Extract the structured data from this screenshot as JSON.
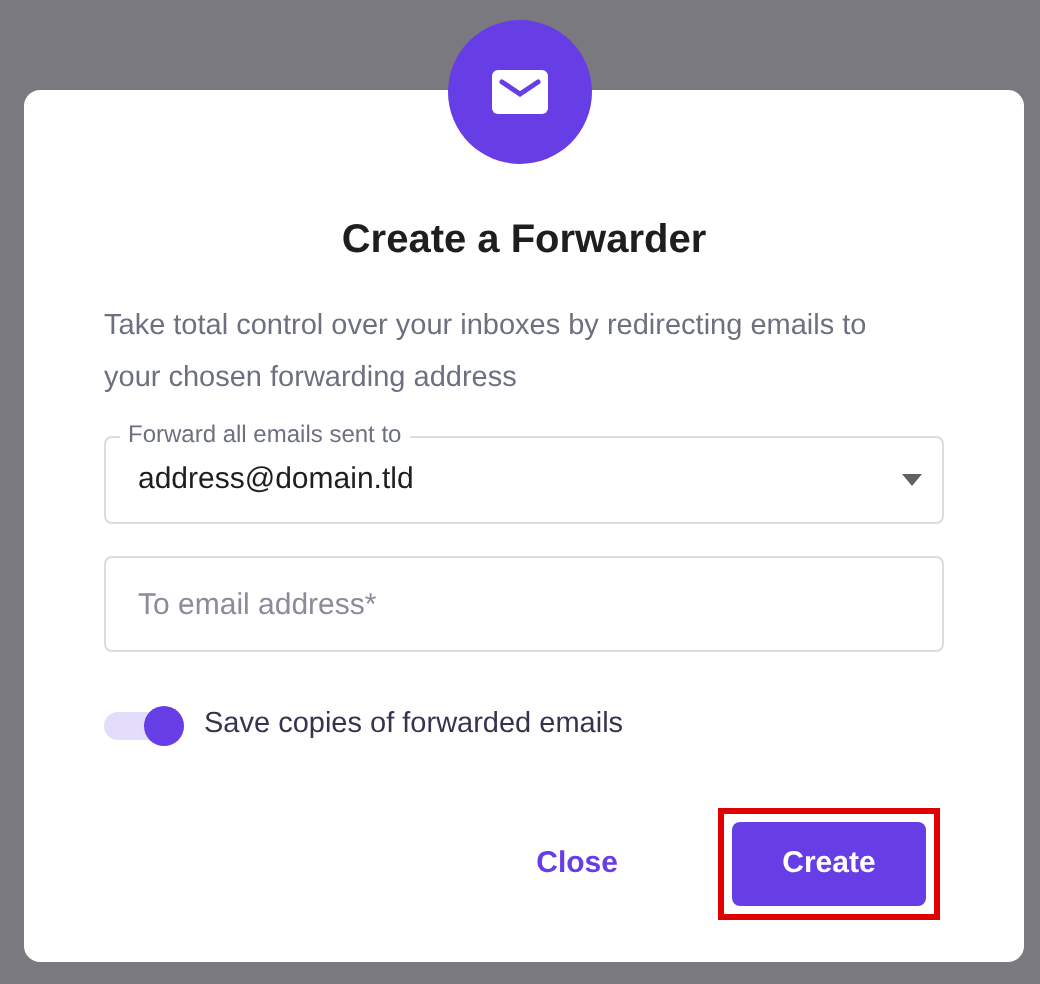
{
  "dialog": {
    "title": "Create a Forwarder",
    "description": "Take total control over your inboxes by redirecting emails to your chosen forwarding address",
    "source_select": {
      "label": "Forward all emails sent to",
      "value": "address@domain.tld"
    },
    "destination_field": {
      "placeholder": "To email address*"
    },
    "save_copies": {
      "label": "Save copies of forwarded emails",
      "on": true
    },
    "buttons": [
      {
        "label": "Close",
        "kind": "text",
        "highlighted": false
      },
      {
        "label": "Create",
        "kind": "primary",
        "highlighted": true
      }
    ]
  }
}
